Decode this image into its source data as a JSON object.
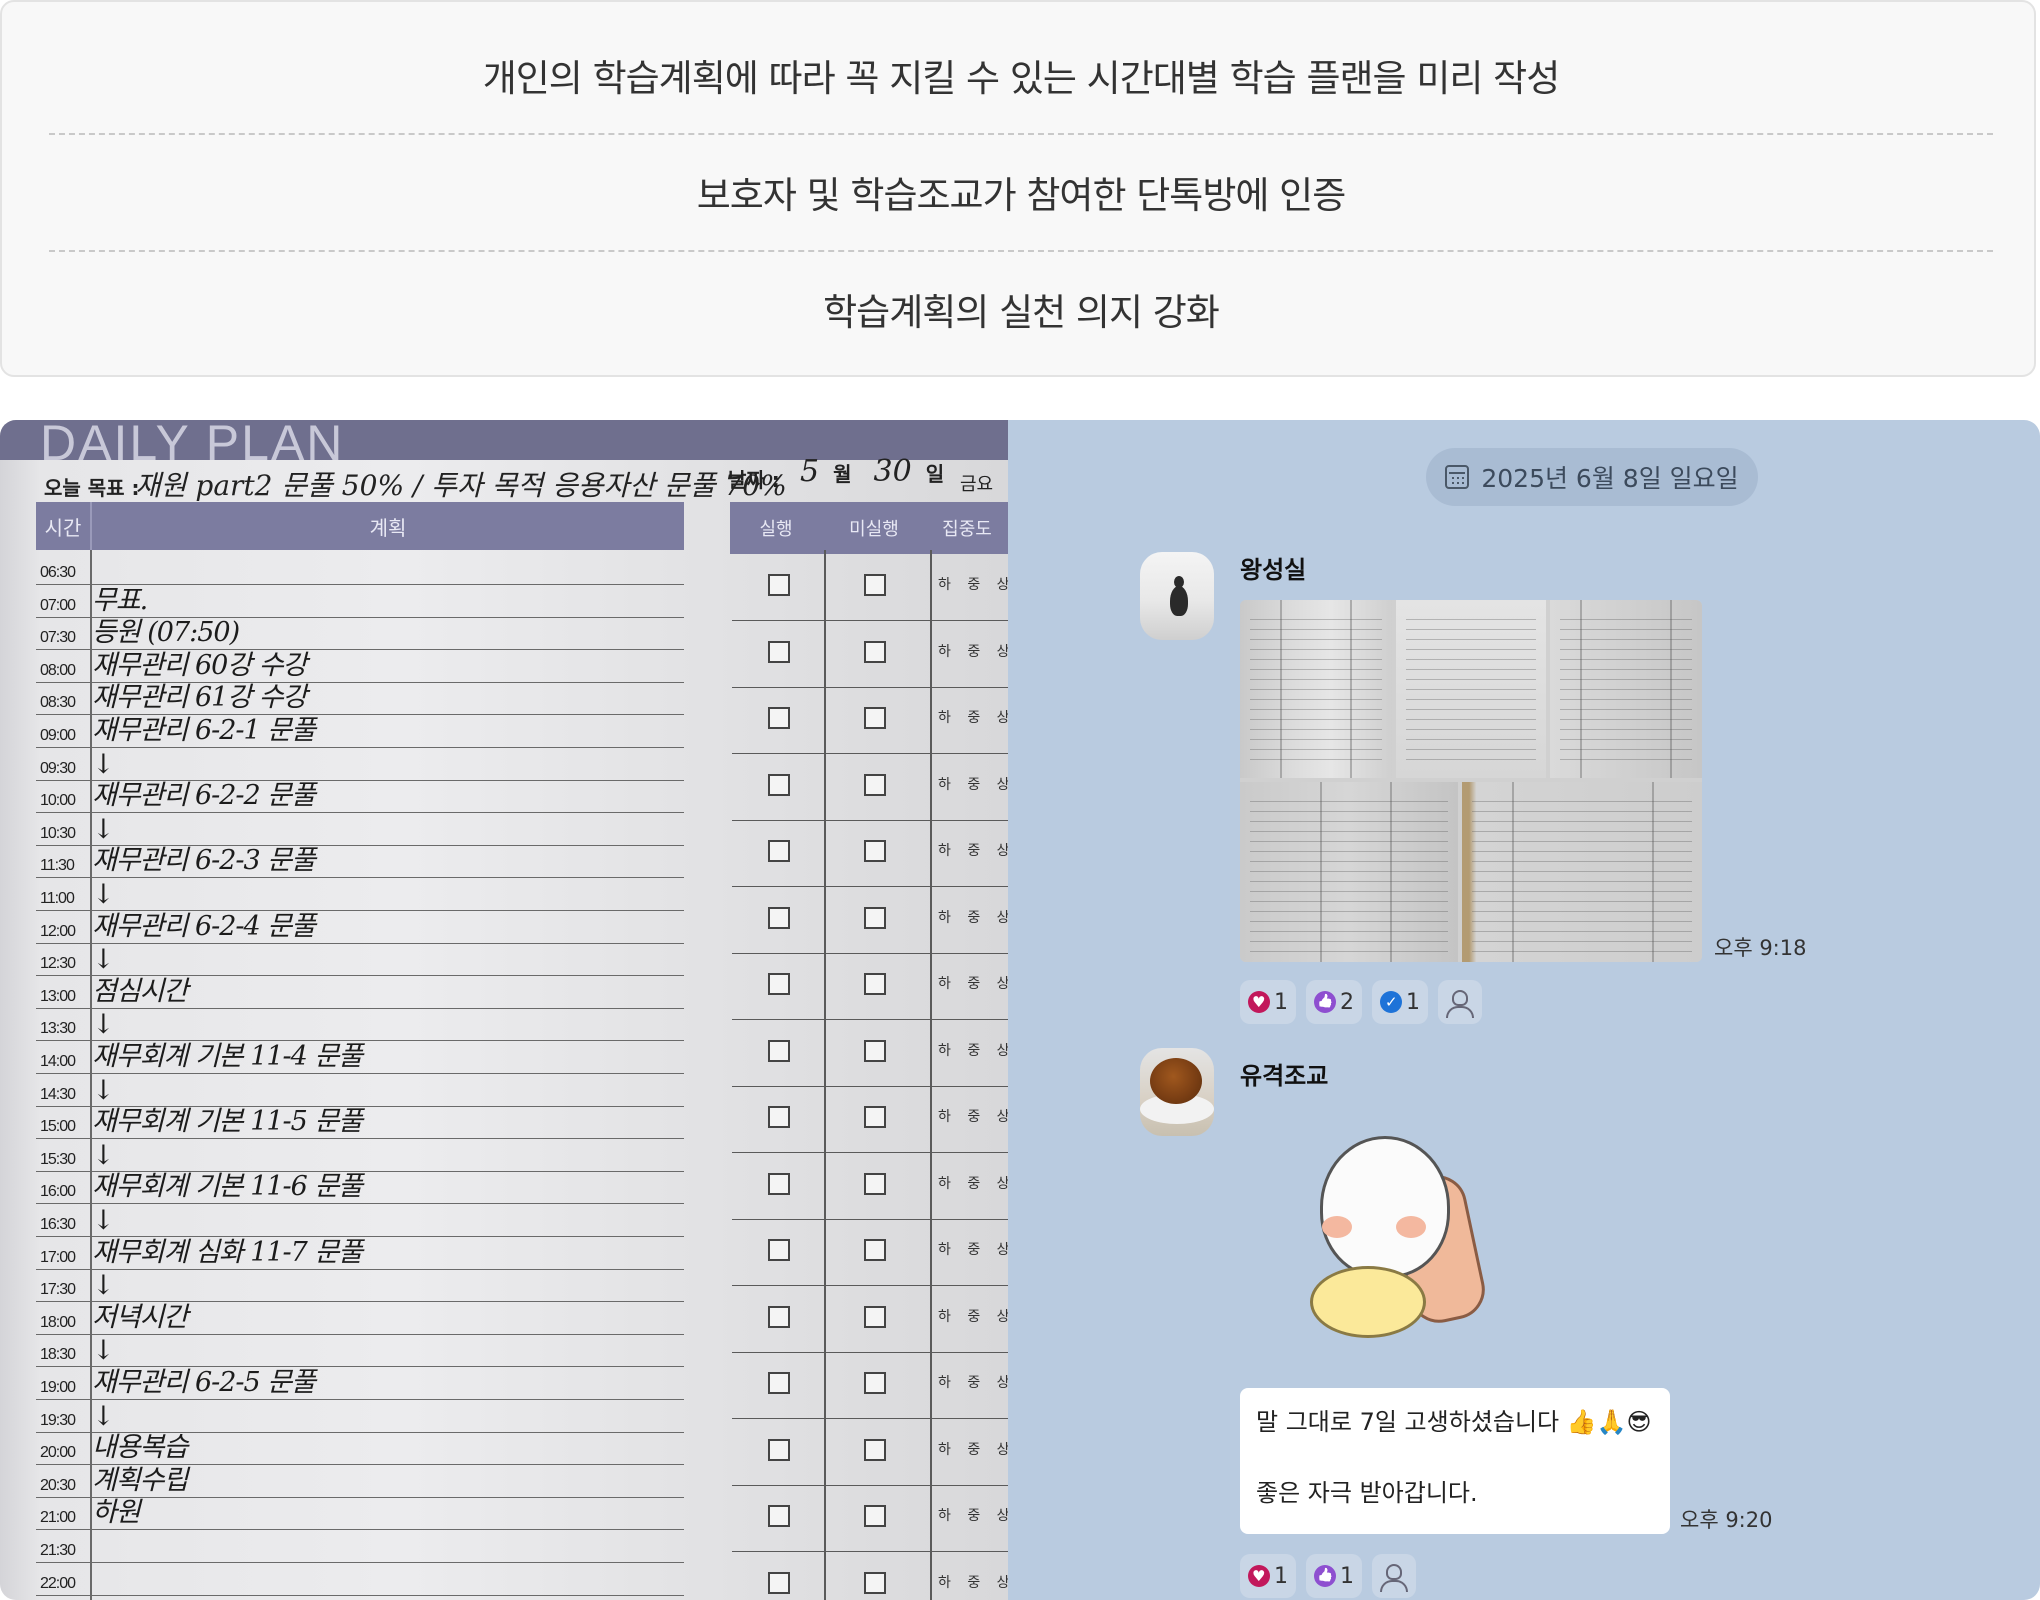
{
  "info": {
    "items": [
      "개인의 학습계획에 따라 꼭 지킬 수 있는 시간대별 학습 플랜을 미리 작성",
      "보호자 및 학습조교가 참여한 단톡방에 인증",
      "학습계획의 실천 의지 강화"
    ]
  },
  "planner": {
    "title": "DAILY PLAN",
    "goal_label": "오늘 목표 :",
    "goal_text": "재원 part2 문풀 50% / 투자 목적 응용자산 문풀 70%",
    "date_label": "날짜 :",
    "month": "5",
    "month_unit": "월",
    "day": "30",
    "day_unit": "일",
    "weekday": "금요",
    "headers": {
      "time": "시간",
      "plan": "계획",
      "done": "실행",
      "not_done": "미실행",
      "focus": "집중도"
    },
    "level_text": "하 중 상",
    "rows": [
      {
        "time": "06:30",
        "plan": ""
      },
      {
        "time": "07:00",
        "plan": "무표."
      },
      {
        "time": "07:30",
        "plan": "등원 (07:50)"
      },
      {
        "time": "08:00",
        "plan": "재무관리 60강 수강"
      },
      {
        "time": "08:30",
        "plan": "재무관리 61강 수강"
      },
      {
        "time": "09:00",
        "plan": "재무관리 6-2-1 문풀"
      },
      {
        "time": "09:30",
        "plan": "↓"
      },
      {
        "time": "10:00",
        "plan": "재무관리 6-2-2 문풀"
      },
      {
        "time": "10:30",
        "plan": "↓"
      },
      {
        "time": "11:30",
        "plan": "재무관리 6-2-3 문풀"
      },
      {
        "time": "11:00",
        "plan": "↓"
      },
      {
        "time": "12:00",
        "plan": "재무관리 6-2-4 문풀"
      },
      {
        "time": "12:30",
        "plan": "↓"
      },
      {
        "time": "13:00",
        "plan": "점심시간"
      },
      {
        "time": "13:30",
        "plan": "↓"
      },
      {
        "time": "14:00",
        "plan": "재무회계 기본 11-4 문풀"
      },
      {
        "time": "14:30",
        "plan": "↓"
      },
      {
        "time": "15:00",
        "plan": "재무회계 기본 11-5 문풀"
      },
      {
        "time": "15:30",
        "plan": "↓"
      },
      {
        "time": "16:00",
        "plan": "재무회계 기본 11-6 문풀"
      },
      {
        "time": "16:30",
        "plan": "↓"
      },
      {
        "time": "17:00",
        "plan": "재무회계 심화 11-7 문풀"
      },
      {
        "time": "17:30",
        "plan": "↓"
      },
      {
        "time": "18:00",
        "plan": "저녁시간"
      },
      {
        "time": "18:30",
        "plan": "↓"
      },
      {
        "time": "19:00",
        "plan": "재무관리 6-2-5 문풀"
      },
      {
        "time": "19:30",
        "plan": "↓"
      },
      {
        "time": "20:00",
        "plan": "내용복습"
      },
      {
        "time": "20:30",
        "plan": "계획수립"
      },
      {
        "time": "21:00",
        "plan": "하원"
      },
      {
        "time": "21:30",
        "plan": ""
      },
      {
        "time": "22:00",
        "plan": ""
      }
    ]
  },
  "chat": {
    "date": "2025년 6월 8일 일요일",
    "msg1": {
      "sender": "왕성실",
      "time": "오후 9:18",
      "reactions": {
        "heart": "1",
        "thumb": "2",
        "check": "1"
      }
    },
    "msg2": {
      "sender": "유격조교",
      "line1": "말 그대로 7일 고생하셨습니다 👍🙏😎",
      "line2": "좋은 자극 받아갑니다.",
      "time": "오후 9:20",
      "reactions": {
        "heart": "1",
        "thumb": "1"
      }
    }
  }
}
